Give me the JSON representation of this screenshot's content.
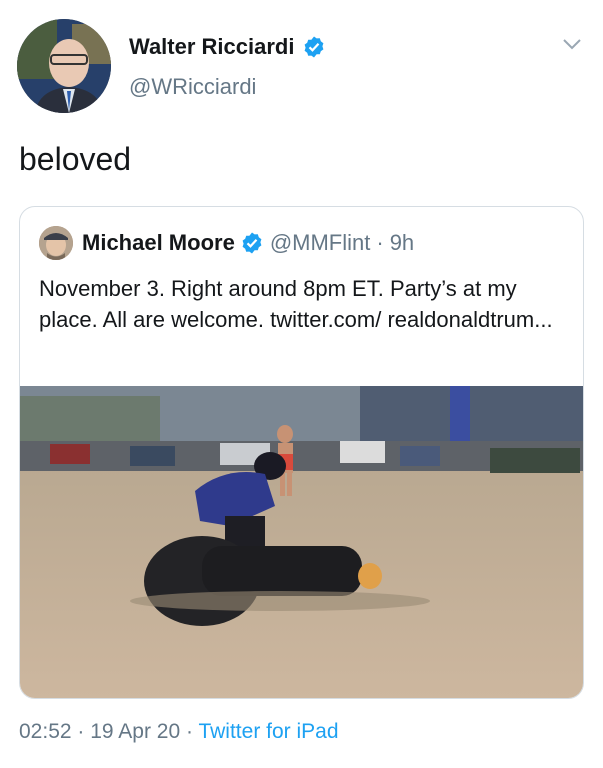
{
  "tweet": {
    "author_name": "Walter Ricciardi",
    "author_handle": "@WRicciardi",
    "text": "beloved",
    "time": "02:52",
    "date": "19 Apr 20",
    "source": "Twitter for iPad",
    "separator": "·"
  },
  "quoted_tweet": {
    "author_name": "Michael Moore",
    "author_handle": "@MMFlint",
    "age": "9h",
    "separator": "·",
    "text": "November 3.  Right around 8pm ET. Party’s at my place. All are welcome. twitter.com/ realdonaldtrum..."
  },
  "icons": {
    "verified": "verified-badge-icon",
    "menu": "chevron-down-icon"
  },
  "colors": {
    "link": "#1da1f2",
    "muted": "#657786",
    "verified": "#1da1f2"
  }
}
